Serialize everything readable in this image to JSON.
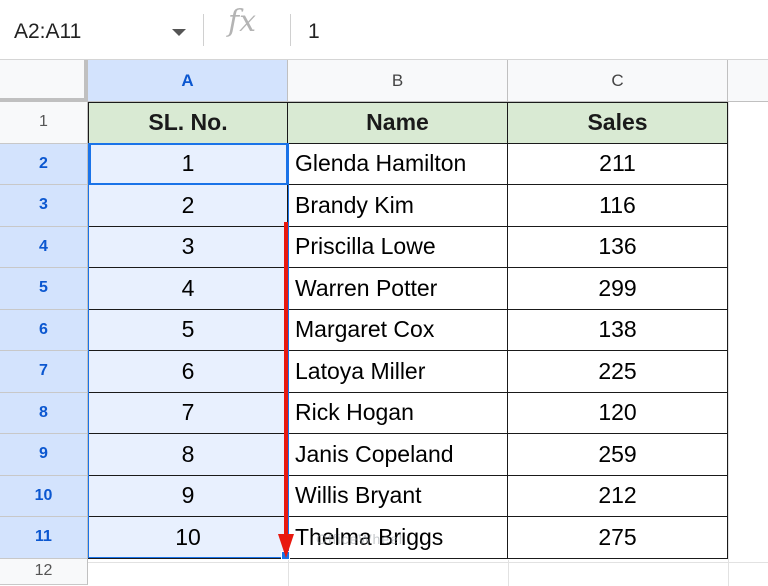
{
  "formula_bar": {
    "name_box": "A2:A11",
    "fx_label": "fx",
    "value": "1"
  },
  "columns": [
    "A",
    "B",
    "C"
  ],
  "rows": [
    "1",
    "2",
    "3",
    "4",
    "5",
    "6",
    "7",
    "8",
    "9",
    "10",
    "11",
    "12"
  ],
  "table": {
    "headers": [
      "SL. No.",
      "Name",
      "Sales"
    ],
    "data": [
      [
        "1",
        "Glenda Hamilton",
        "211"
      ],
      [
        "2",
        "Brandy Kim",
        "116"
      ],
      [
        "3",
        "Priscilla Lowe",
        "136"
      ],
      [
        "4",
        "Warren Potter",
        "299"
      ],
      [
        "5",
        "Margaret Cox",
        "138"
      ],
      [
        "6",
        "Latoya Miller",
        "225"
      ],
      [
        "7",
        "Rick Hogan",
        "120"
      ],
      [
        "8",
        "Janis Copeland",
        "259"
      ],
      [
        "9",
        "Willis Bryant",
        "212"
      ],
      [
        "10",
        "Thelma Briggs",
        "275"
      ]
    ]
  },
  "watermark": "OfficeWheel",
  "colors": {
    "header_fill": "#d9ead3",
    "selection_fill": "#e8f0fe",
    "selection_border": "#1a73e8",
    "arrow": "#e8190f"
  },
  "icons": {
    "name_box_dropdown": "chevron-down-icon",
    "formula": "fx-icon",
    "arrow": "down-arrow-annotation-icon",
    "fill_handle": "fill-handle-icon"
  }
}
